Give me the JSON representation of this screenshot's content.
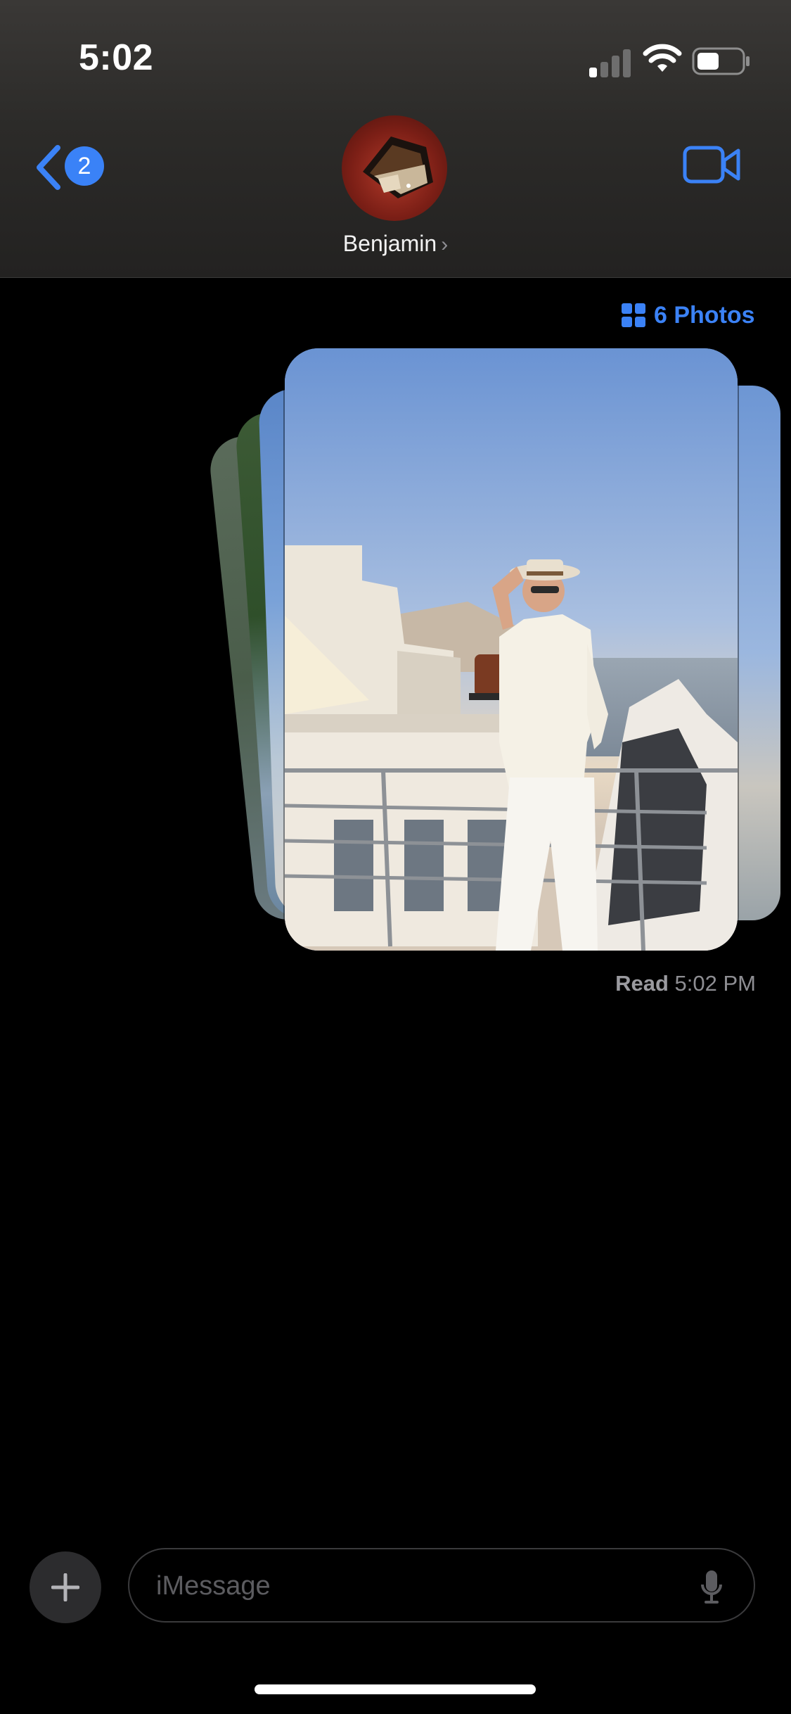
{
  "status_bar": {
    "time": "5:02",
    "icons": [
      "cellular-signal-icon",
      "wifi-icon",
      "battery-icon"
    ]
  },
  "nav": {
    "back_badge_count": "2",
    "contact_name": "Benjamin",
    "contact_chevron": "›",
    "icons": [
      "back-chevron-icon",
      "video-camera-icon"
    ]
  },
  "conversation": {
    "photos_link_label": "6 Photos",
    "photos_icon": "grid-icon",
    "read_label": "Read",
    "read_time": "5:02 PM"
  },
  "composer": {
    "placeholder": "iMessage",
    "value": "",
    "icons": [
      "plus-icon",
      "microphone-icon"
    ]
  },
  "colors": {
    "accent": "#3b82f6",
    "background": "#000000",
    "header": "#2c2b29",
    "secondary_text": "#8e8e93"
  }
}
